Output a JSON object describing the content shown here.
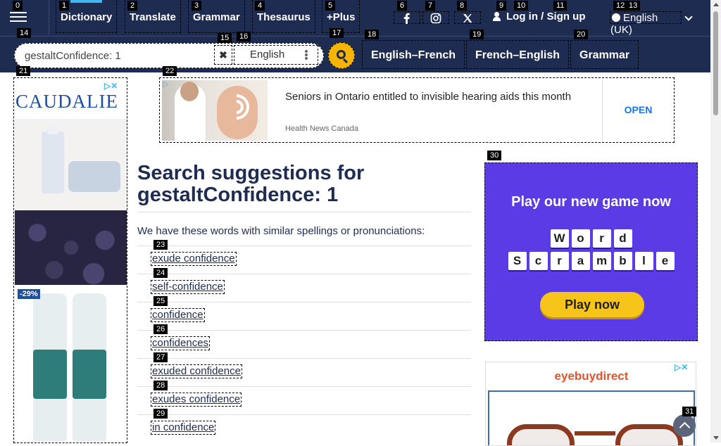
{
  "nav": {
    "links": [
      {
        "label": "Dictionary",
        "tag": "1"
      },
      {
        "label": "Translate",
        "tag": "2"
      },
      {
        "label": "Grammar",
        "tag": "3"
      },
      {
        "label": "Thesaurus",
        "tag": "4"
      },
      {
        "label": "+Plus",
        "tag": "5"
      }
    ],
    "login": "Log in",
    "slash": "/",
    "signup": "Sign up",
    "language": "English (UK)",
    "tags": {
      "menu": "0",
      "facebook": "6",
      "instagram": "7",
      "x": "8",
      "login_icon": "9",
      "login": "10",
      "signup": "11",
      "lang_a": "12",
      "lang_b": "13"
    }
  },
  "search": {
    "value": "gestaltConfidence: 1",
    "language": "English",
    "pairs": [
      "English–French",
      "French–English",
      "Grammar"
    ],
    "tags": {
      "input": "14",
      "clear": "15",
      "lang": "16",
      "go": "17",
      "pair0": "18",
      "pair1": "19",
      "pair2": "20"
    }
  },
  "ads": {
    "left": {
      "brand": "CAUDALIE",
      "discount": "-29%",
      "tag": "21"
    },
    "top": {
      "title": "Seniors in Ontario entitled to invisible hearing aids this month",
      "source": "Health News Canada",
      "cta": "OPEN",
      "tag": "22"
    },
    "game": {
      "title": "Play our new game now",
      "word1": [
        "W",
        "o",
        "r",
        "d"
      ],
      "word2": [
        "S",
        "c",
        "r",
        "a",
        "m",
        "b",
        "l",
        "e"
      ],
      "cta": "Play now",
      "tag": "30"
    },
    "eyewear": {
      "brand": "eyebuydirect"
    }
  },
  "main": {
    "title_prefix": "Search suggestions for",
    "query": "gestaltConfidence: 1",
    "similar_text": "We have these words with similar spellings or pronunciations:",
    "suggestions": [
      {
        "text": "exude confidence",
        "tag": "23"
      },
      {
        "text": "self-confidence",
        "tag": "24"
      },
      {
        "text": "confidence",
        "tag": "25"
      },
      {
        "text": "confidences",
        "tag": "26"
      },
      {
        "text": "exuded confidence",
        "tag": "27"
      },
      {
        "text": "exudes confidence",
        "tag": "28"
      },
      {
        "text": "in confidence",
        "tag": "29"
      }
    ]
  },
  "scroll_top_tag": "31",
  "colors": {
    "nav_bg": "#1f2c52",
    "accent": "#f7b500",
    "link": "#1f2c52",
    "game_bg": "#5a3be6"
  }
}
